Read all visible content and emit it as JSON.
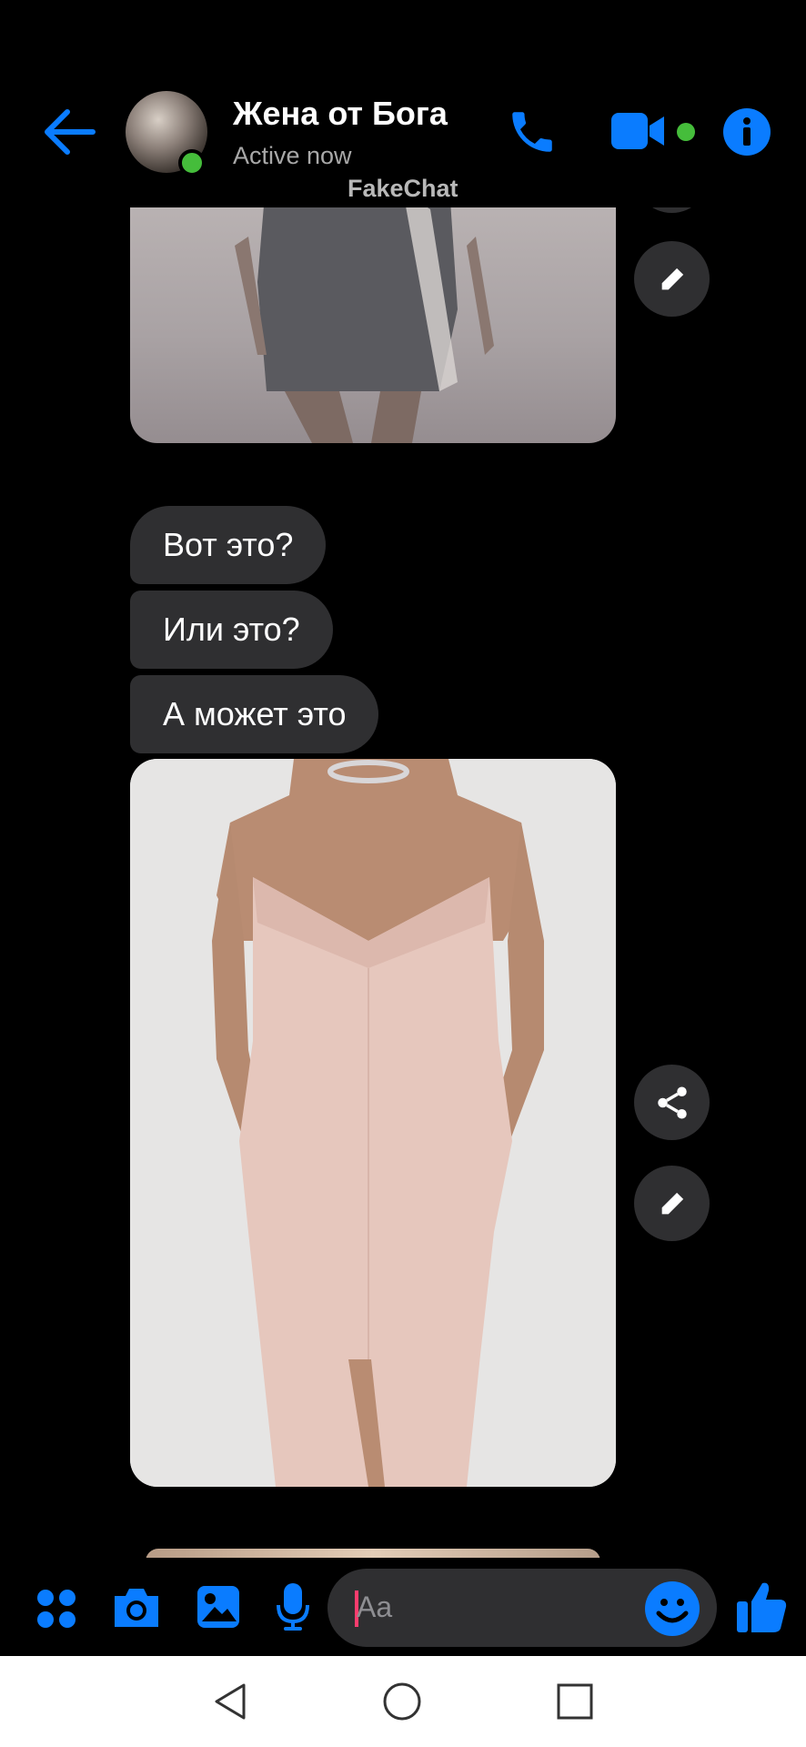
{
  "header": {
    "contact_name": "Жена от Бога",
    "status": "Active now",
    "watermark": "FakeChat"
  },
  "messages": [
    {
      "type": "image",
      "description_id": "photo-dress-grey"
    },
    {
      "type": "text",
      "text": "Вот это?"
    },
    {
      "type": "text",
      "text": "Или это?"
    },
    {
      "type": "text",
      "text": "А может это"
    },
    {
      "type": "image",
      "description_id": "photo-dress-pink"
    }
  ],
  "composer": {
    "placeholder": "Aa"
  },
  "colors": {
    "accent": "#0a7cff",
    "bubble": "#2f2f31",
    "online": "#45bd3b",
    "background": "#000000"
  },
  "icons": [
    "back-arrow-icon",
    "phone-icon",
    "video-camera-icon",
    "info-icon",
    "share-icon",
    "edit-icon",
    "apps-icon",
    "camera-icon",
    "gallery-icon",
    "microphone-icon",
    "emoji-icon",
    "like-thumb-icon",
    "nav-back-icon",
    "nav-home-icon",
    "nav-recents-icon"
  ]
}
